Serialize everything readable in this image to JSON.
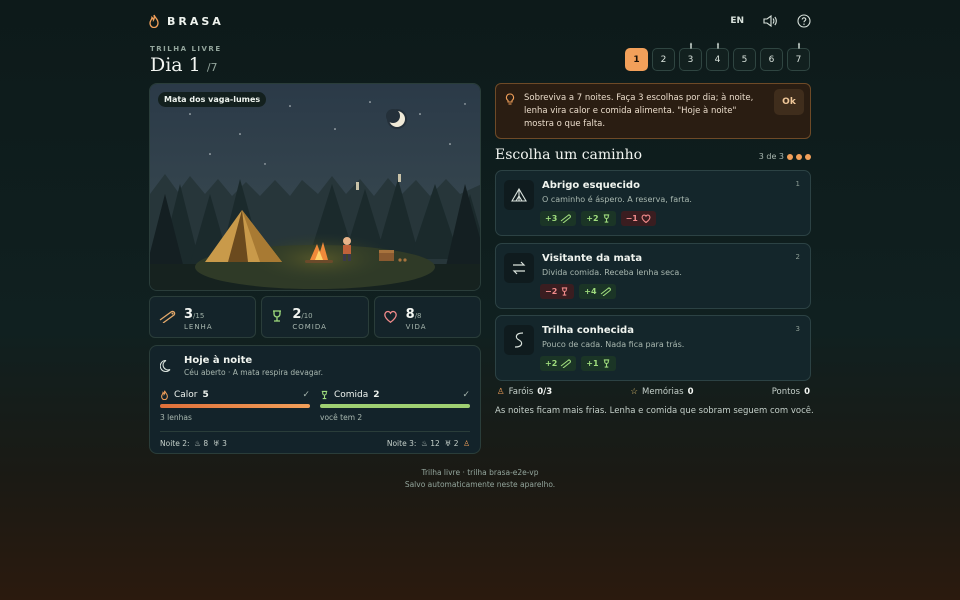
{
  "brand": {
    "name": "BRASA"
  },
  "header": {
    "lang": "EN"
  },
  "trail": {
    "label": "TRILHA LIVRE",
    "day_title": "Dia 1",
    "day_of": "/7"
  },
  "days": [
    {
      "label": "1",
      "active": true,
      "marked": false
    },
    {
      "label": "2",
      "active": false,
      "marked": false
    },
    {
      "label": "3",
      "active": false,
      "marked": true
    },
    {
      "label": "4",
      "active": false,
      "marked": true
    },
    {
      "label": "5",
      "active": false,
      "marked": false
    },
    {
      "label": "6",
      "active": false,
      "marked": false
    },
    {
      "label": "7",
      "active": false,
      "marked": true
    }
  ],
  "scene": {
    "tag": "Mata dos vaga-lumes"
  },
  "stats": [
    {
      "value": "3",
      "max": "/15",
      "label": "LENHA",
      "icon": "log-icon"
    },
    {
      "value": "2",
      "max": "/10",
      "label": "COMIDA",
      "icon": "food-icon"
    },
    {
      "value": "8",
      "max": "/8",
      "label": "VIDA",
      "icon": "heart-icon"
    }
  ],
  "tonight": {
    "title": "Hoje à noite",
    "subtitle": "Céu aberto · A mata respira devagar.",
    "warmth": {
      "label": "Calor",
      "value": "5",
      "note": "3 lenhas",
      "fill": 1.0
    },
    "food": {
      "label": "Comida",
      "value": "2",
      "note": "você tem 2",
      "fill": 1.0
    },
    "night2": {
      "label": "Noite 2:",
      "fire": "8",
      "food": "3"
    },
    "night3": {
      "label": "Noite 3:",
      "fire": "12",
      "food": "2"
    }
  },
  "tip": {
    "text": "Sobreviva a 7 noites. Faça 3 escolhas por dia; à noite, lenha vira calor e comida alimenta. \"Hoje à noite\" mostra o que falta.",
    "ok": "Ok"
  },
  "choose": {
    "title": "Escolha um caminho",
    "progress": "3 de 3"
  },
  "cards": [
    {
      "name": "Abrigo esquecido",
      "desc": "O caminho é áspero. A reserva, farta.",
      "num": "1",
      "icon": "tent-icon",
      "effects": [
        {
          "text": "+3",
          "kind": "pos",
          "icon": "log"
        },
        {
          "text": "+2",
          "kind": "pos",
          "icon": "food"
        },
        {
          "text": "−1",
          "kind": "neg",
          "icon": "heart"
        }
      ]
    },
    {
      "name": "Visitante da mata",
      "desc": "Divida comida. Receba lenha seca.",
      "num": "2",
      "icon": "swap-icon",
      "effects": [
        {
          "text": "−2",
          "kind": "neg",
          "icon": "food"
        },
        {
          "text": "+4",
          "kind": "pos",
          "icon": "log"
        }
      ]
    },
    {
      "name": "Trilha conhecida",
      "desc": "Pouco de cada. Nada fica para trás.",
      "num": "3",
      "icon": "path-icon",
      "effects": [
        {
          "text": "+2",
          "kind": "pos",
          "icon": "log"
        },
        {
          "text": "+1",
          "kind": "pos",
          "icon": "food"
        }
      ]
    }
  ],
  "meta": {
    "farois_label": "Faróis",
    "farois": "0/3",
    "memorias_label": "Memórias",
    "memorias": "0",
    "pontos_label": "Pontos",
    "pontos": "0"
  },
  "note": "As noites ficam mais frias. Lenha e comida que sobram seguem com você.",
  "footer": {
    "line1": "Trilha livre · trilha brasa-e2e-vp",
    "line2": "Salvo automaticamente neste aparelho."
  },
  "colors": {
    "accent": "#f2a05a",
    "positive": "#9fdc7d",
    "negative": "#f08a8a"
  }
}
